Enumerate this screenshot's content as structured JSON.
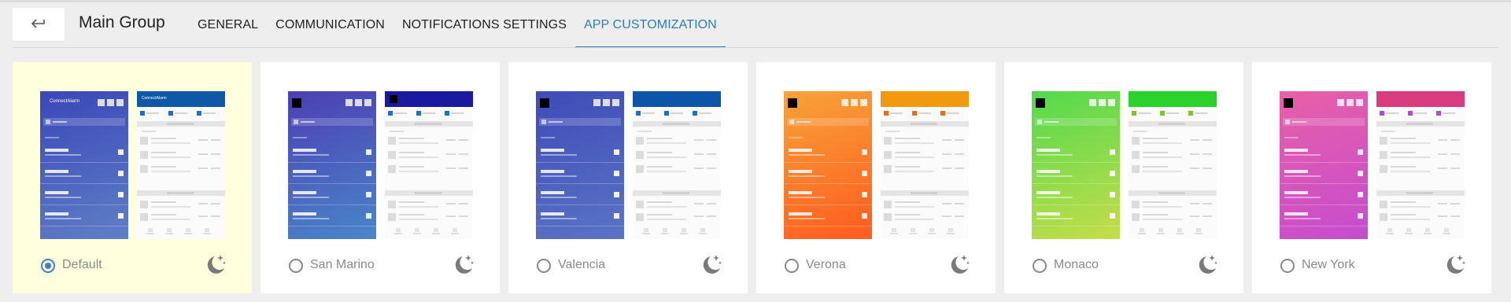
{
  "header": {
    "back_icon": "arrow-left-icon",
    "title": "Main Group",
    "tabs": [
      {
        "label": "GENERAL",
        "active": false
      },
      {
        "label": "COMMUNICATION",
        "active": false
      },
      {
        "label": "NOTIFICATIONS SETTINGS",
        "active": false
      },
      {
        "label": "APP CUSTOMIZATION",
        "active": true
      }
    ]
  },
  "colors": {
    "accent": "#2f7ac4",
    "selected_card": "#ffffdd"
  },
  "themes": [
    {
      "name": "Default",
      "selected": true,
      "brand_text": "ConnectAlarm",
      "gradient": [
        "#3a47b8",
        "#5f7fc6"
      ],
      "header": "#0f58a8",
      "check": "#1d6fd0",
      "icon": "crescent-moon-stars-icon"
    },
    {
      "name": "San Marino",
      "selected": false,
      "gradient": [
        "#4c3fb3",
        "#4a86c9"
      ],
      "header": "#1a1aa0",
      "check": "#1d6fd0",
      "icon": "crescent-moon-stars-icon"
    },
    {
      "name": "Valencia",
      "selected": false,
      "gradient": [
        "#3f4bb8",
        "#5a74c4"
      ],
      "header": "#0c55a8",
      "check": "#1d6fd0",
      "icon": "crescent-moon-stars-icon"
    },
    {
      "name": "Verona",
      "selected": false,
      "gradient": [
        "#f7a339",
        "#ff5b1f"
      ],
      "header": "#f19a10",
      "check": "#ef6d12",
      "icon": "crescent-moon-stars-icon"
    },
    {
      "name": "Monaco",
      "selected": false,
      "gradient": [
        "#52d94d",
        "#c6dd4a"
      ],
      "header": "#2cd22c",
      "check": "#7bc71f",
      "icon": "crescent-moon-stars-icon"
    },
    {
      "name": "New York",
      "selected": false,
      "gradient": [
        "#e860a7",
        "#c54ccf"
      ],
      "header": "#d93c7e",
      "check": "#b64ad2",
      "icon": "crescent-moon-stars-icon"
    }
  ]
}
